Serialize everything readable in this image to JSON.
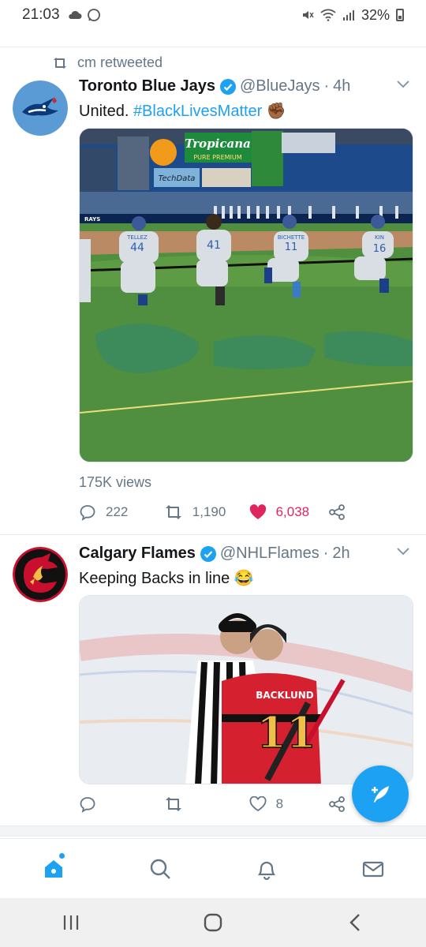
{
  "status_bar": {
    "time": "21:03",
    "battery": "32%",
    "icons": [
      "cloud-icon",
      "whatsapp-icon",
      "mute-icon",
      "wifi-icon",
      "signal-icon",
      "battery-icon"
    ]
  },
  "tweets": [
    {
      "retweet_label": "cm retweeted",
      "display_name": "Toronto Blue Jays",
      "verified": true,
      "handle": "@BlueJays",
      "age": "4h",
      "text": "United. ",
      "hashtag": "#BlackLivesMatter",
      "emoji": "✊🏾",
      "media_alt": "Blue Jays players kneeling on baseball field at Tropicana Field",
      "media_signs": {
        "tropicana": "Tropicana",
        "pure_premium": "PURE PREMIUM",
        "techdata": "TechData",
        "rays": "RAYS",
        "jersey_numbers": [
          "44",
          "41",
          "11",
          "16"
        ],
        "jersey_names": [
          "TELLEZ",
          "",
          "BICHETTE",
          "KIN"
        ]
      },
      "views": "175K views",
      "reply_count": "222",
      "retweet_count": "1,190",
      "like_count": "6,038",
      "liked": true
    },
    {
      "display_name": "Calgary Flames",
      "verified": true,
      "handle": "@NHLFlames",
      "age": "2h",
      "text": "Keeping Backs in line ",
      "emoji": "😂",
      "media_alt": "Hockey referee talking with Calgary Flames player Backlund number 11",
      "media_signs": {
        "player_name": "BACKLUND",
        "player_number": "11"
      },
      "reply_count": "",
      "retweet_count": "",
      "like_count": "8"
    }
  ],
  "colors": {
    "accent": "#1da1f2",
    "like": "#e0245e",
    "muted": "#657786"
  },
  "bottom_nav": [
    "home-icon",
    "search-icon",
    "notifications-icon",
    "messages-icon"
  ],
  "system_nav": [
    "recents-icon",
    "home-icon",
    "back-icon"
  ]
}
